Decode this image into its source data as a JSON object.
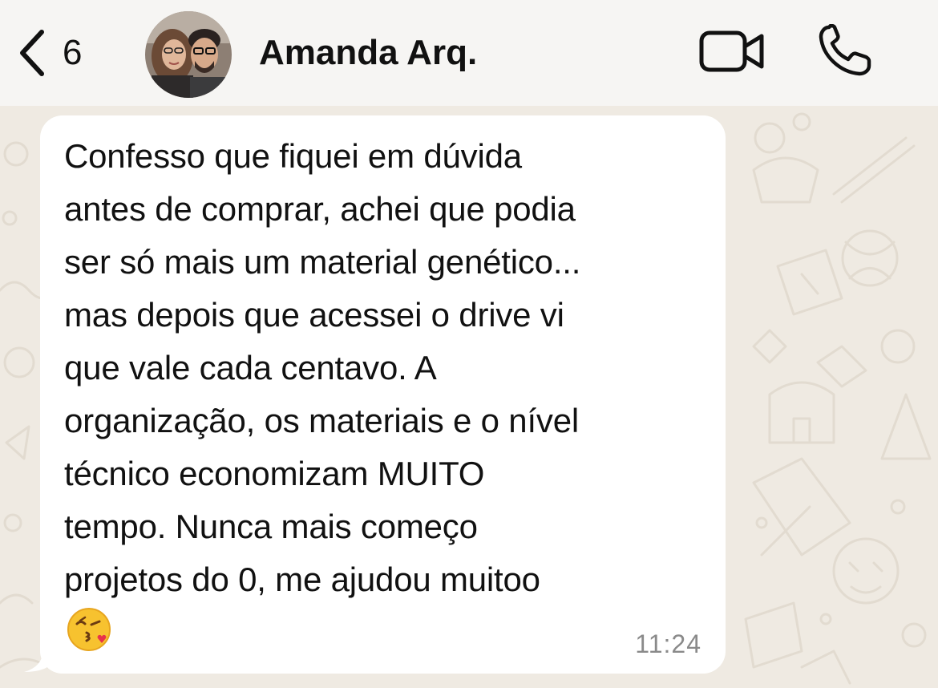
{
  "header": {
    "back_count": "6",
    "contact_name": "Amanda Arq."
  },
  "icons": {
    "back": "chevron-left-icon",
    "video": "video-camera-icon",
    "call": "phone-icon",
    "emoji": "kissing-face-with-heart-emoji"
  },
  "message": {
    "text": "Confesso que fiquei em dúvida\nantes de comprar, achei que podia\nser só mais um material genético...\nmas depois que acessei o drive vi\nque vale cada centavo. A\norganização, os materiais e o nível\ntécnico economizam MUITO\ntempo. Nunca mais começo\nprojetos do 0, me ajudou muitoo",
    "time": "11:24"
  },
  "colors": {
    "header_bg": "#f6f5f3",
    "chat_bg": "#efeae2",
    "bubble_bg": "#ffffff",
    "time_text": "#8a8a8a"
  }
}
